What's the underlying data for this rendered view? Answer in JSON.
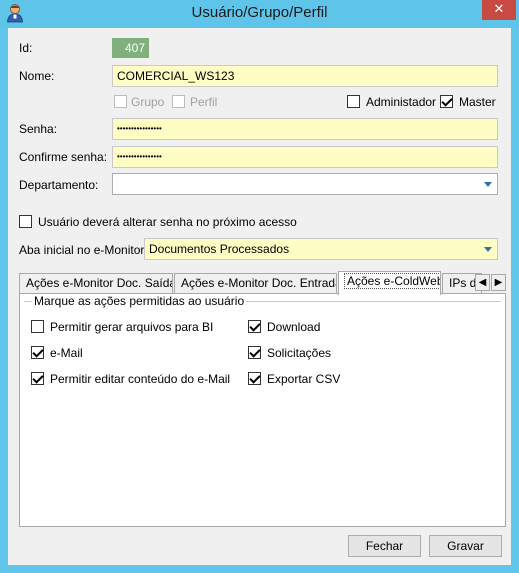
{
  "window": {
    "title": "Usuário/Grupo/Perfil",
    "close_symbol": "✕"
  },
  "form": {
    "id_label": "Id:",
    "id_value": "407",
    "nome_label": "Nome:",
    "nome_value": "COMERCIAL_WS123",
    "grupo_label": "Grupo",
    "perfil_label": "Perfil",
    "administrador_label": "Administador",
    "master_label": "Master",
    "senha_label": "Senha:",
    "senha_value": "••••••••••••••••",
    "confirme_label": "Confirme senha:",
    "confirme_value": "••••••••••••••••",
    "departamento_label": "Departamento:",
    "departamento_value": "",
    "alterar_senha_label": "Usuário deverá alterar senha no próximo acesso",
    "aba_inicial_label": "Aba inicial no e-Monitor:",
    "aba_inicial_value": "Documentos Processados"
  },
  "tabs": [
    {
      "label": "Ações e-Monitor Doc. Saída"
    },
    {
      "label": "Ações e-Monitor Doc. Entrada"
    },
    {
      "label": "Ações e-ColdWeb"
    },
    {
      "label": "IPs de"
    }
  ],
  "panel": {
    "group_title": "Marque as ações permitidas ao usuário",
    "actions": [
      {
        "label": "Permitir gerar arquivos para BI",
        "checked": false
      },
      {
        "label": "Download",
        "checked": true
      },
      {
        "label": "e-Mail",
        "checked": true
      },
      {
        "label": "Solicitações",
        "checked": true
      },
      {
        "label": "Permitir editar conteúdo do e-Mail",
        "checked": true
      },
      {
        "label": "Exportar CSV",
        "checked": true
      }
    ]
  },
  "buttons": {
    "fechar": "Fechar",
    "gravar": "Gravar"
  },
  "colors": {
    "titlebar": "#5ec4ea",
    "required_field": "#fdfdc4",
    "id_box": "#80b07d",
    "close_button": "#c74a43"
  }
}
